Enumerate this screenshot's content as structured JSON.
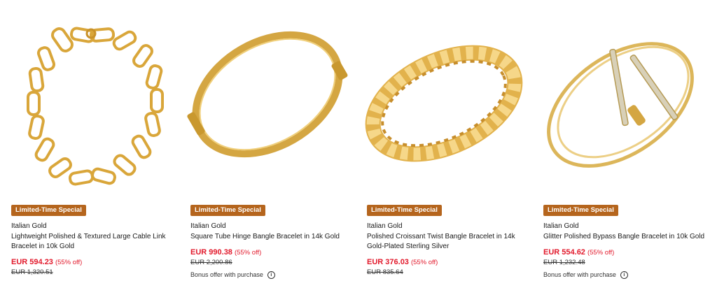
{
  "products": [
    {
      "badge": "Limited-Time Special",
      "brand": "Italian Gold",
      "title": "Lightweight Polished & Textured Large Cable Link Bracelet in 10k Gold",
      "price": "EUR 594.23",
      "discount": "(55% off)",
      "original_price": "EUR 1,320.51",
      "bonus": "",
      "image_icon": "cable-link-bracelet-icon"
    },
    {
      "badge": "Limited-Time Special",
      "brand": "Italian Gold",
      "title": "Square Tube Hinge Bangle Bracelet in 14k Gold",
      "price": "EUR 990.38",
      "discount": "(55% off)",
      "original_price": "EUR 2,200.86",
      "bonus": "Bonus offer with purchase",
      "image_icon": "hinge-bangle-icon"
    },
    {
      "badge": "Limited-Time Special",
      "brand": "Italian Gold",
      "title": "Polished Croissant Twist Bangle Bracelet in 14k Gold-Plated Sterling Silver",
      "price": "EUR 376.03",
      "discount": "(55% off)",
      "original_price": "EUR 835.64",
      "bonus": "",
      "image_icon": "croissant-bangle-icon"
    },
    {
      "badge": "Limited-Time Special",
      "brand": "Italian Gold",
      "title": "Glitter Polished Bypass Bangle Bracelet in 10k Gold",
      "price": "EUR 554.62",
      "discount": "(55% off)",
      "original_price": "EUR 1,232.48",
      "bonus": "Bonus offer with purchase",
      "image_icon": "bypass-bangle-icon"
    }
  ],
  "info_icon_glyph": "i",
  "colors": {
    "badge": "#b5651d",
    "sale_price": "#e21a2c",
    "gold": "#d9a63a"
  }
}
